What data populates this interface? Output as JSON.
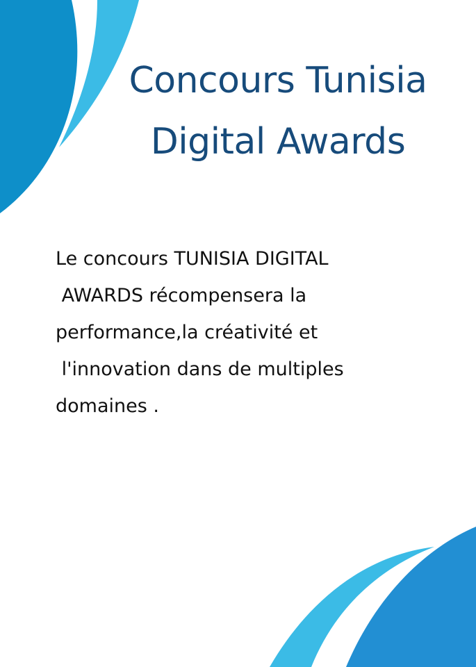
{
  "colors": {
    "background": "#ffffff",
    "title": "#174b7b",
    "body_text": "#111111",
    "dark_blue": "#0e8fc9",
    "light_blue": "#3bbbe6",
    "bottom_blue": "#228fd3"
  },
  "title": {
    "line1": "Concours Tunisia",
    "line2": "Digital Awards"
  },
  "description": {
    "lines": [
      "Le concours TUNISIA DIGITAL",
      " AWARDS récompensera la",
      "performance,la créativité et",
      " l'innovation dans de multiples",
      "domaines ."
    ]
  }
}
